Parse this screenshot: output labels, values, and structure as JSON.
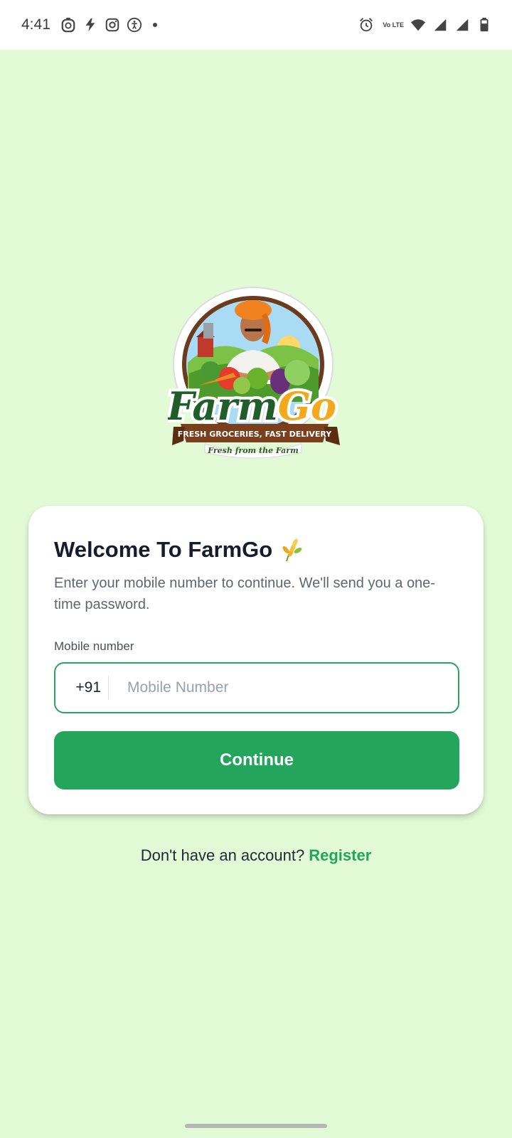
{
  "status_bar": {
    "time": "4:41",
    "left_icons": [
      "timer-icon",
      "bolt-icon",
      "instagram-icon",
      "accessibility-icon"
    ],
    "network": "Vo LTE",
    "right_icons": [
      "alarm-icon",
      "wifi-icon",
      "signal-icon",
      "signal-icon-2",
      "battery-icon"
    ]
  },
  "logo": {
    "brand_part1": "Farm",
    "brand_part2": "Go",
    "banner": "FRESH GROCERIES, FAST DELIVERY",
    "tagline": "Fresh from the Farm"
  },
  "login_card": {
    "title": "Welcome To FarmGo",
    "subtitle": "Enter your mobile number to continue. We'll send you a one-time password.",
    "field_label": "Mobile number",
    "country_code": "+91",
    "phone_placeholder": "Mobile Number",
    "phone_value": "",
    "continue_label": "Continue"
  },
  "register_prompt": {
    "text": "Don't have an account?",
    "link_label": "Register"
  },
  "colors": {
    "background": "#e2fad6",
    "accent": "#23a55c",
    "title": "#161c2d"
  }
}
